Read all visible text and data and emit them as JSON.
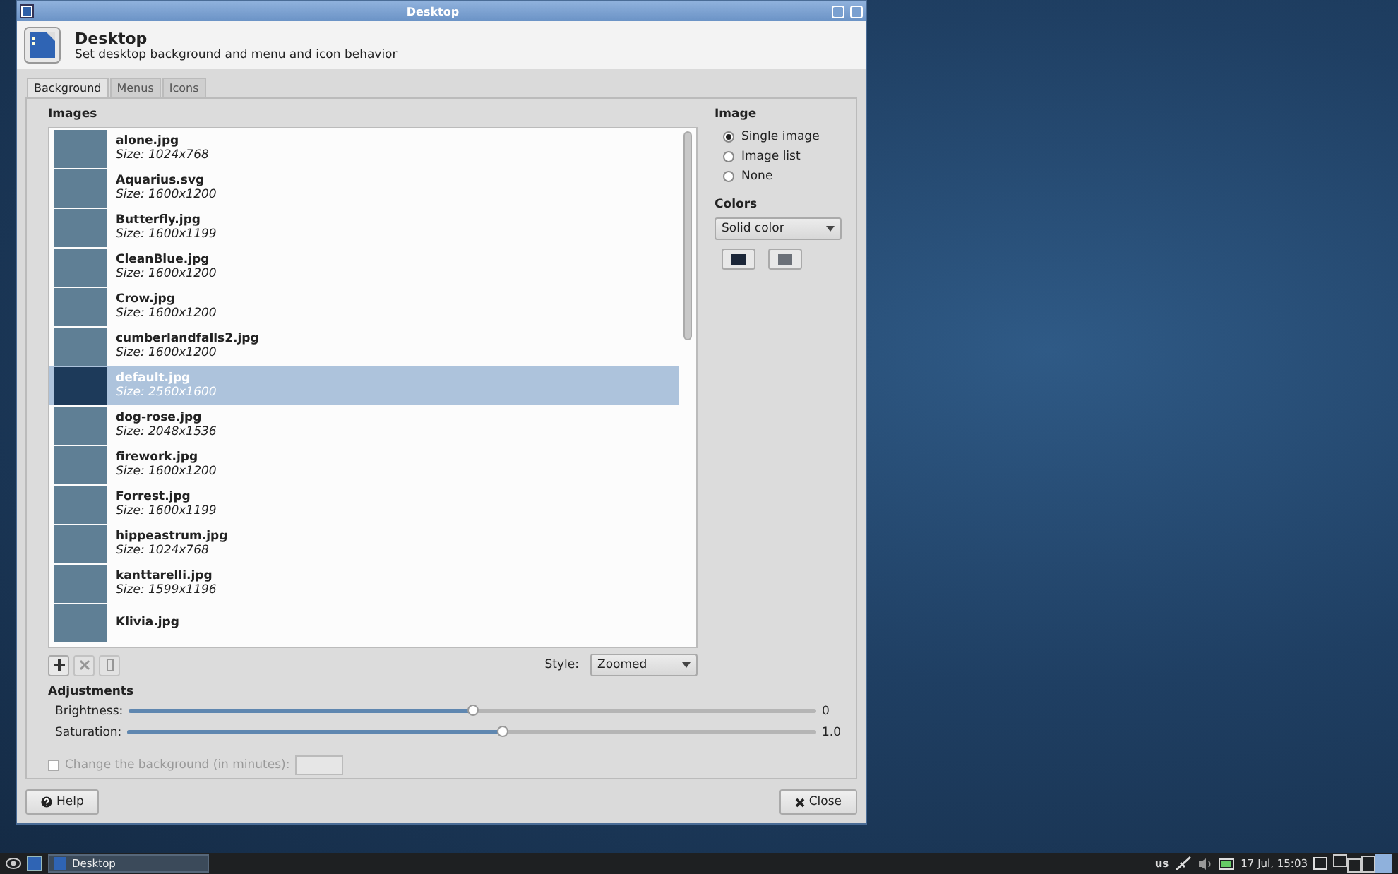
{
  "window": {
    "title": "Desktop"
  },
  "header": {
    "title": "Desktop",
    "subtitle": "Set desktop background and menu and icon behavior"
  },
  "tabs": [
    {
      "label": "Background",
      "selected": true
    },
    {
      "label": "Menus",
      "selected": false
    },
    {
      "label": "Icons",
      "selected": false
    }
  ],
  "images": {
    "label": "Images",
    "items": [
      {
        "name": "alone.jpg",
        "size": "Size: 1024x768",
        "selected": false
      },
      {
        "name": "Aquarius.svg",
        "size": "Size: 1600x1200",
        "selected": false
      },
      {
        "name": "Butterfly.jpg",
        "size": "Size: 1600x1199",
        "selected": false
      },
      {
        "name": "CleanBlue.jpg",
        "size": "Size: 1600x1200",
        "selected": false
      },
      {
        "name": "Crow.jpg",
        "size": "Size: 1600x1200",
        "selected": false
      },
      {
        "name": "cumberlandfalls2.jpg",
        "size": "Size: 1600x1200",
        "selected": false
      },
      {
        "name": "default.jpg",
        "size": "Size: 2560x1600",
        "selected": true
      },
      {
        "name": "dog-rose.jpg",
        "size": "Size: 2048x1536",
        "selected": false
      },
      {
        "name": "firework.jpg",
        "size": "Size: 1600x1200",
        "selected": false
      },
      {
        "name": "Forrest.jpg",
        "size": "Size: 1600x1199",
        "selected": false
      },
      {
        "name": "hippeastrum.jpg",
        "size": "Size: 1024x768",
        "selected": false
      },
      {
        "name": "kanttarelli.jpg",
        "size": "Size: 1599x1196",
        "selected": false
      },
      {
        "name": "Klivia.jpg",
        "selected": false
      }
    ]
  },
  "list_buttons": [
    {
      "kind": "add",
      "disabled": false
    },
    {
      "kind": "remove",
      "disabled": true
    },
    {
      "kind": "folder",
      "disabled": true
    }
  ],
  "style": {
    "label": "Style:",
    "value": "Zoomed"
  },
  "image_mode": {
    "label": "Image",
    "options": [
      {
        "label": "Single image",
        "selected": true
      },
      {
        "label": "Image list",
        "selected": false
      },
      {
        "label": "None",
        "selected": false
      }
    ]
  },
  "colors": {
    "label": "Colors",
    "value": "Solid color",
    "swatches": [
      {
        "color": "#1b2638"
      },
      {
        "color": "#6b7078"
      }
    ]
  },
  "adjustments": {
    "label": "Adjustments",
    "sliders": [
      {
        "label": "Brightness:",
        "level": 0.5,
        "reading": "0"
      },
      {
        "label": "Saturation:",
        "level": 0.545,
        "reading": "1.0"
      }
    ]
  },
  "change_background": {
    "label": "Change the background (in minutes):",
    "checked": false,
    "disabled": true
  },
  "buttons": [
    {
      "kind": "help",
      "label": "Help"
    },
    {
      "kind": "close",
      "label": "Close"
    }
  ],
  "taskbar": {
    "task": "Desktop",
    "keyboard": "us",
    "clock": "17 Jul, 15:03"
  }
}
